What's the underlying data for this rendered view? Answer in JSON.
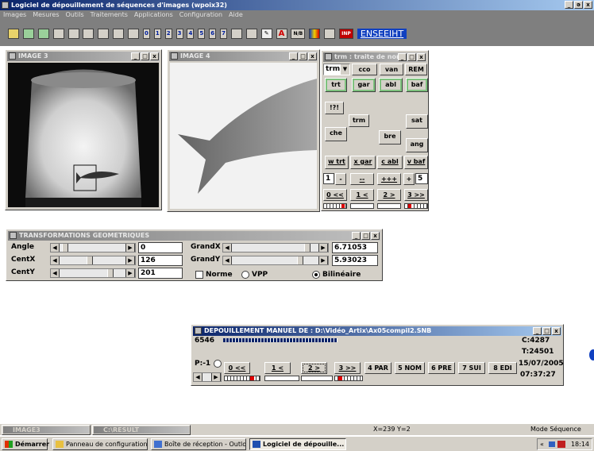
{
  "app": {
    "title": "Logiciel de dépouillement de séquences d'images (wpoix32)",
    "menu": [
      "Images",
      "Mesures",
      "Outils",
      "Traitements",
      "Applications",
      "Configuration",
      "Aide"
    ],
    "toolbar_digits": [
      "0",
      "1",
      "2",
      "3",
      "4",
      "5",
      "6",
      "7"
    ],
    "toolbar_labels": {
      "nb": "N/B",
      "a": "A",
      "inp": "INP",
      "link": "ENSEEIHT"
    },
    "controls": [
      "_",
      "ə",
      "x"
    ]
  },
  "win_image3": {
    "title": "IMAGE 3",
    "controls": [
      "_",
      "□",
      "x"
    ]
  },
  "win_image4": {
    "title": "IMAGE 4",
    "controls": [
      "_",
      "□",
      "x"
    ]
  },
  "win_trm": {
    "title": "trm : traite de nom",
    "combo": "trm",
    "buttons": {
      "cco": "cco",
      "van": "van",
      "rem": "REM",
      "trt": "trt",
      "gar": "gar",
      "abl": "abl",
      "baf": "baf",
      "q": "!?!",
      "trm": "trm",
      "sat": "sat",
      "che": "che",
      "bre": "bre",
      "ang": "ang",
      "wtrt": "w trt",
      "xgar": "x gar",
      "cabl": "c abl",
      "vbaf": "v baf",
      "minus": "-",
      "dash": "--",
      "plus3": "+++",
      "plus": "+",
      "n0": "0 <<",
      "n1": "1 <",
      "n2": "2 >",
      "n3": "3 >>"
    },
    "field1": "1",
    "field5": "5"
  },
  "win_transform": {
    "title": "TRANSFORMATIONS GEOMETRIQUES",
    "angle_label": "Angle",
    "angle_value": "0",
    "angle_pos": 0.05,
    "centx_label": "CentX",
    "centx_value": "126",
    "centx_pos": 0.45,
    "centy_label": "CentY",
    "centy_value": "201",
    "centy_pos": 0.78,
    "grandx_label": "GrandX",
    "grandx_value": "6.71053",
    "grandx_pos": 0.88,
    "grandy_label": "GrandY",
    "grandy_value": "5.93023",
    "grandy_pos": 0.8,
    "norme_label": "Norme",
    "vpp_label": "VPP",
    "bilin_label": "Bilinéaire",
    "selected": "Bilinéaire"
  },
  "win_depouillement": {
    "title": "DEPOUILLEMENT MANUEL DE : D:\\Vidéo_Artix\\Ax05compil2.SNB",
    "frame": "6546",
    "p_label": "P:-1",
    "c_value": "C:4287",
    "t_value": "T:24501",
    "date": "15/07/2005",
    "time": "07:37:27",
    "nav": [
      "0 <<",
      "1 <",
      "2 >",
      "3 >>",
      "4 PAR",
      "5 NOM",
      "6 PRE",
      "7 SUI",
      "8 EDI"
    ],
    "progress": 0.4
  },
  "minimized": [
    {
      "title": "IMAGE3"
    },
    {
      "title": "C:\\RESULT"
    }
  ],
  "statusbar": {
    "coords": "X=239  Y=2",
    "mode": "Mode Séquence"
  },
  "taskbar": {
    "start": "Démarrer",
    "tasks": [
      "Panneau de configuration",
      "Boîte de réception - Outlo...",
      "Logiciel de dépouille..."
    ],
    "clock": "18:14",
    "tray_chevron": "«"
  }
}
